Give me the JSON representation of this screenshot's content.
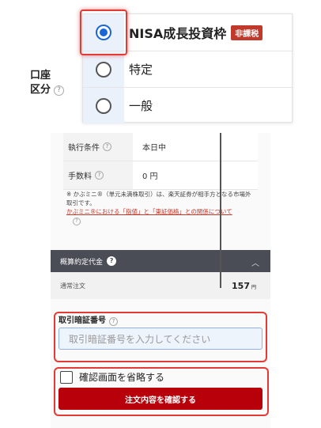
{
  "account": {
    "label_line1": "口座",
    "label_line2": "区分",
    "help": "?",
    "options": [
      {
        "label": "NISA成長投資枠",
        "badge": "非課税",
        "selected": true
      },
      {
        "label": "特定",
        "selected": false
      },
      {
        "label": "一般",
        "selected": false
      }
    ]
  },
  "details": {
    "rows": [
      {
        "key": "執行条件",
        "help": "?",
        "value": "本日中"
      },
      {
        "key": "手数料",
        "help": "?",
        "value": "0 円"
      }
    ],
    "note": "※ かぶミニ®（単元未満株取引）は、楽天証券が相手方となる市場外取引です。",
    "link": "かぶミニ®における「指値」と「東証価格」との関係について",
    "link_help": "?"
  },
  "estimate": {
    "title": "概算約定代金",
    "chevron": "︿",
    "order_type": "通常注文",
    "amount": "157",
    "unit": "円"
  },
  "password": {
    "label": "取引暗証番号",
    "help": "?",
    "placeholder": "取引暗証番号を入力してください"
  },
  "confirm": {
    "skip_label": "確認画面を省略する",
    "submit_label": "注文内容を確認する"
  },
  "colors": {
    "accent": "#1a66d6",
    "danger": "#b8000b",
    "highlight": "#e53935"
  }
}
